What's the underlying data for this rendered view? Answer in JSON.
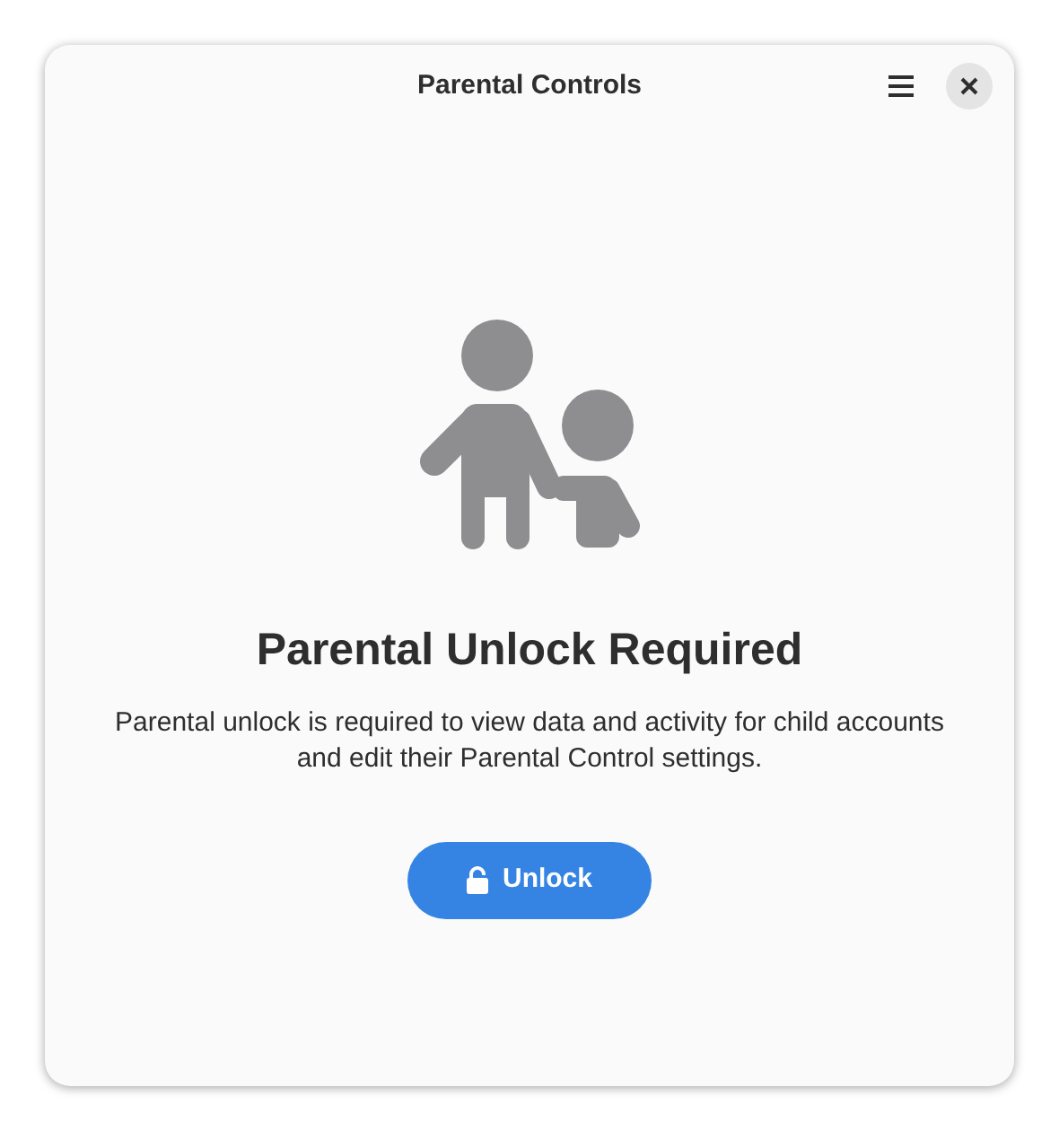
{
  "window": {
    "title": "Parental Controls"
  },
  "header_buttons": [
    {
      "kind": "menu"
    },
    {
      "kind": "close"
    }
  ],
  "heading": "Parental Unlock Required",
  "description": "Parental unlock is required to view data and activity for child accounts and edit their Parental Control settings.",
  "unlock_button": {
    "label": "Unlock"
  }
}
